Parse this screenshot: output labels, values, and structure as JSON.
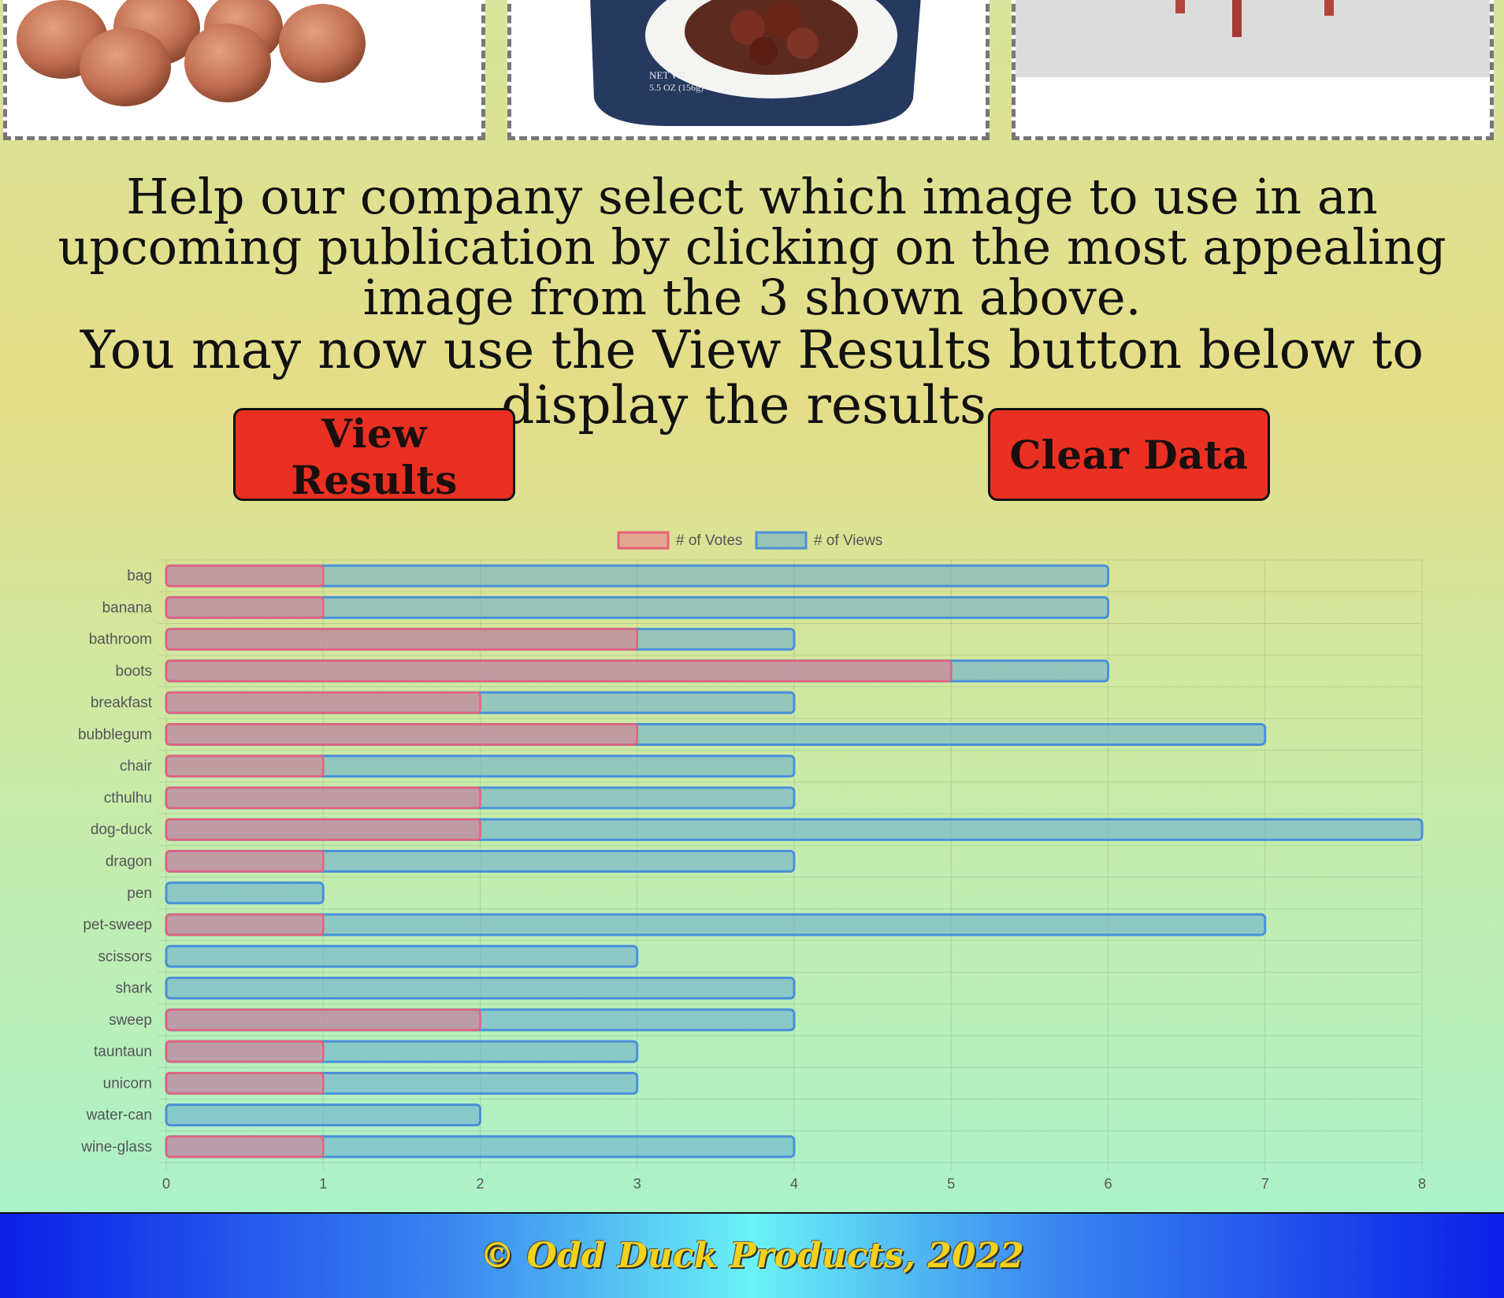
{
  "products": [
    {
      "name": "bubblegum",
      "alt": "bubblegum"
    },
    {
      "name": "dog-duck",
      "alt": "canned meatballs on a plate",
      "label_text": [
        "NET WT",
        "5.5 OZ (156g)"
      ]
    },
    {
      "name": "chair",
      "alt": "chair"
    }
  ],
  "prompt": {
    "line1": "Help our company select which image to use in an upcoming publication by clicking on the most appealing image from the 3 shown above.",
    "line2": "You may now use the View Results button below to display the results."
  },
  "buttons": {
    "view_results": "View Results",
    "clear_data": "Clear Data"
  },
  "colors": {
    "button": "#ea3022",
    "votes_fill": "rgba(230,120,140,0.55)",
    "votes_border": "#e8607a",
    "views_fill": "rgba(100,170,210,0.55)",
    "views_border": "#4a90d9",
    "footer_text": "#f2d21a"
  },
  "chart_data": {
    "type": "bar",
    "orientation": "horizontal",
    "categories": [
      "bag",
      "banana",
      "bathroom",
      "boots",
      "breakfast",
      "bubblegum",
      "chair",
      "cthulhu",
      "dog-duck",
      "dragon",
      "pen",
      "pet-sweep",
      "scissors",
      "shark",
      "sweep",
      "tauntaun",
      "unicorn",
      "water-can",
      "wine-glass"
    ],
    "series": [
      {
        "name": "# of Votes",
        "values": [
          1,
          1,
          3,
          5,
          2,
          3,
          1,
          2,
          2,
          1,
          0,
          1,
          0,
          0,
          2,
          1,
          1,
          0,
          1
        ]
      },
      {
        "name": "# of Views",
        "values": [
          6,
          6,
          4,
          6,
          4,
          7,
          4,
          4,
          8,
          4,
          1,
          7,
          3,
          4,
          4,
          3,
          3,
          2,
          4
        ]
      }
    ],
    "xlim": [
      0,
      8
    ],
    "xticks": [
      0,
      1,
      2,
      3,
      4,
      5,
      6,
      7,
      8
    ],
    "grid": true,
    "legend": "top-center"
  },
  "footer": {
    "text": "© Odd Duck Products, 2022"
  }
}
